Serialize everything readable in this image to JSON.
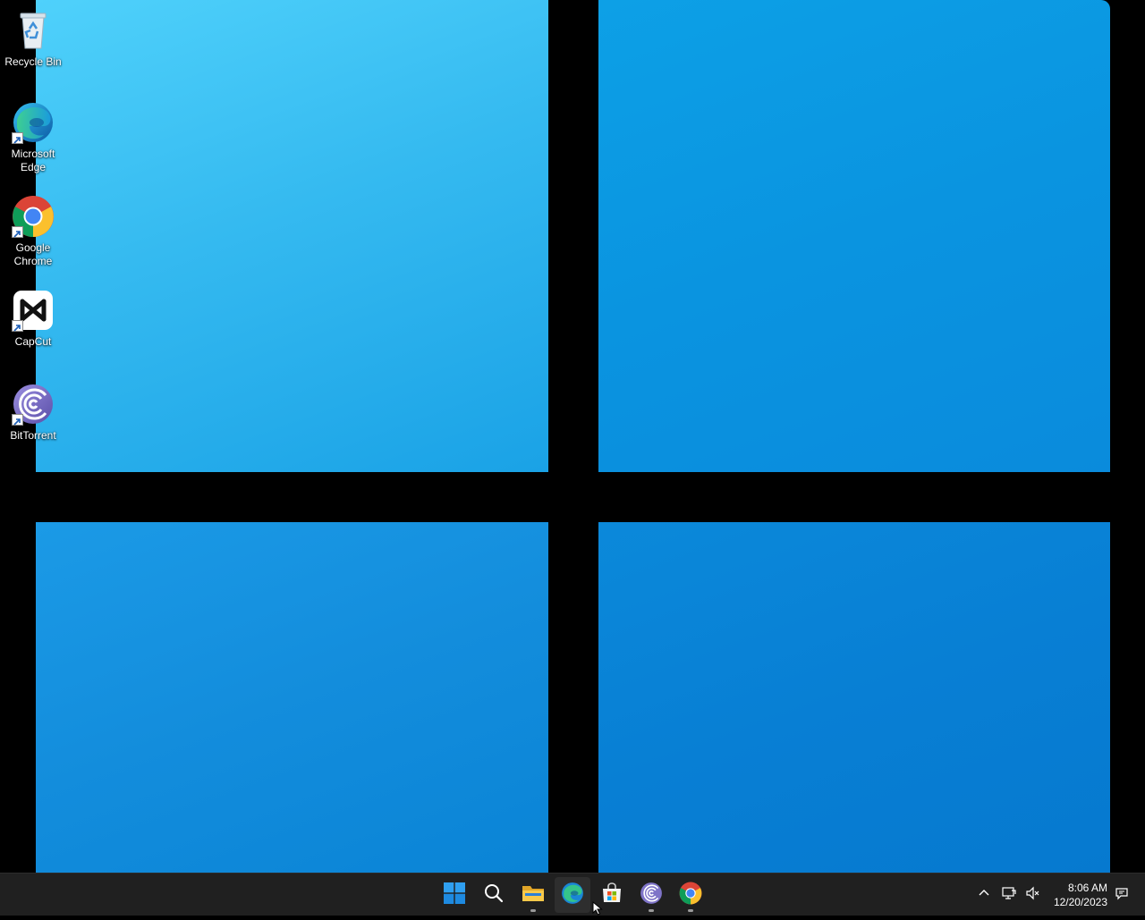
{
  "desktop": {
    "icons": [
      {
        "label": "Recycle Bin",
        "icon": "recycle-bin-icon",
        "shortcut": false
      },
      {
        "label": "Microsoft Edge",
        "icon": "edge-icon",
        "shortcut": true
      },
      {
        "label": "Google Chrome",
        "icon": "chrome-icon",
        "shortcut": true
      },
      {
        "label": "CapCut",
        "icon": "capcut-icon",
        "shortcut": true
      },
      {
        "label": "BitTorrent",
        "icon": "bittorrent-icon",
        "shortcut": true
      }
    ]
  },
  "taskbar": {
    "apps": [
      {
        "icon": "windows-start-icon",
        "running": false
      },
      {
        "icon": "search-icon",
        "running": false
      },
      {
        "icon": "file-explorer-icon",
        "running": true
      },
      {
        "icon": "edge-icon",
        "running": false
      },
      {
        "icon": "microsoft-store-icon",
        "running": false
      },
      {
        "icon": "bittorrent-icon",
        "running": true
      },
      {
        "icon": "chrome-icon",
        "running": true
      }
    ],
    "tray": {
      "overflow_icon": "chevron-up-icon",
      "network_icon": "network-icon",
      "volume_icon": "volume-muted-icon",
      "notification_icon": "notification-icon"
    },
    "clock": {
      "time": "8:06 AM",
      "date": "12/20/2023"
    }
  },
  "colors": {
    "taskbar": "#202020",
    "wallpaper_light": "#4fd1fb",
    "wallpaper_dark": "#0679cf"
  }
}
